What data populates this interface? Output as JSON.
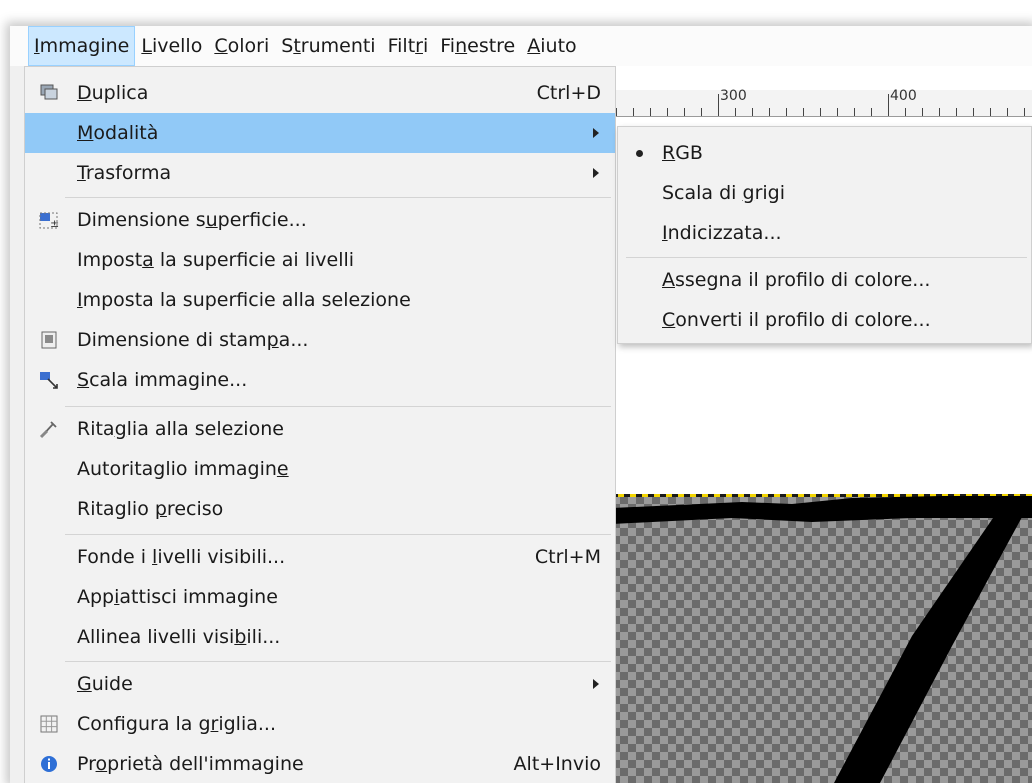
{
  "menubar": [
    {
      "pre": "",
      "u": "I",
      "post": "mmagine",
      "active": true
    },
    {
      "pre": "",
      "u": "L",
      "post": "ivello"
    },
    {
      "pre": "",
      "u": "C",
      "post": "olori"
    },
    {
      "pre": "S",
      "u": "t",
      "post": "rumenti"
    },
    {
      "pre": "Filt",
      "u": "r",
      "post": "i"
    },
    {
      "pre": "Fi",
      "u": "n",
      "post": "estre"
    },
    {
      "pre": "",
      "u": "A",
      "post": "iuto"
    }
  ],
  "ruler": {
    "labels": [
      "300",
      "400"
    ]
  },
  "menu_items": [
    {
      "name": "duplica",
      "pre": "",
      "u": "D",
      "post": "uplica",
      "shortcut": "Ctrl+D",
      "icon": "duplicate-icon"
    },
    {
      "name": "modalita",
      "pre": "",
      "u": "M",
      "post": "odalità",
      "submenu": true,
      "highlighted": true
    },
    {
      "name": "trasforma",
      "pre": "",
      "u": "T",
      "post": "rasforma",
      "submenu": true
    },
    {
      "name": "dimensione-superficie",
      "pre": "Dimensione s",
      "u": "u",
      "post": "perficie...",
      "icon": "canvas-size-icon"
    },
    {
      "name": "imposta-superficie-livelli",
      "pre": "Impost",
      "u": "a",
      "post": " la superficie ai livelli"
    },
    {
      "name": "imposta-superficie-selezione",
      "pre": "",
      "u": "I",
      "post": "mposta la superficie alla selezione"
    },
    {
      "name": "dimensione-stampa",
      "pre": "Dimensione di stam",
      "u": "p",
      "post": "a...",
      "icon": "print-size-icon"
    },
    {
      "name": "scala-immagine",
      "pre": "",
      "u": "S",
      "post": "cala immagine...",
      "icon": "scale-image-icon"
    },
    {
      "name": "ritaglia-selezione",
      "pre": "Rita",
      "u": "g",
      "post": "lia alla selezione",
      "icon": "crop-icon"
    },
    {
      "name": "autoritaglio",
      "pre": "Autoritaglio immagin",
      "u": "e",
      "post": ""
    },
    {
      "name": "ritaglio-preciso",
      "pre": "Ritaglio ",
      "u": "p",
      "post": "reciso"
    },
    {
      "name": "fonde-livelli",
      "pre": "Fonde i ",
      "u": "l",
      "post": "ivelli visibili...",
      "shortcut": "Ctrl+M"
    },
    {
      "name": "appiattisci",
      "pre": "App",
      "u": "i",
      "post": "attisci immagine"
    },
    {
      "name": "allinea-livelli",
      "pre": "Allinea livelli visi",
      "u": "b",
      "post": "ili..."
    },
    {
      "name": "guide",
      "pre": "",
      "u": "G",
      "post": "uide",
      "submenu": true
    },
    {
      "name": "configura-griglia",
      "pre": "Configura la g",
      "u": "r",
      "post": "iglia...",
      "icon": "grid-icon"
    },
    {
      "name": "proprieta-immagine",
      "pre": "Pr",
      "u": "o",
      "post": "prietà dell'immagine",
      "shortcut": "Alt+Invio",
      "icon": "info-icon"
    }
  ],
  "submenu_items": [
    {
      "name": "rgb",
      "pre": "",
      "u": "R",
      "post": "GB",
      "selected": true
    },
    {
      "name": "scala-grigi",
      "pre": "Scala di ",
      "u": "g",
      "post": "rigi"
    },
    {
      "name": "indicizzata",
      "pre": "",
      "u": "I",
      "post": "ndicizzata..."
    },
    {
      "name": "assegna-profilo",
      "pre": "",
      "u": "A",
      "post": "ssegna il profilo di colore..."
    },
    {
      "name": "converti-profilo",
      "pre": "",
      "u": "C",
      "post": "onverti il profilo di colore..."
    }
  ],
  "colors": {
    "highlight": "#91c9f7",
    "menubar_active": "#cce8ff"
  }
}
